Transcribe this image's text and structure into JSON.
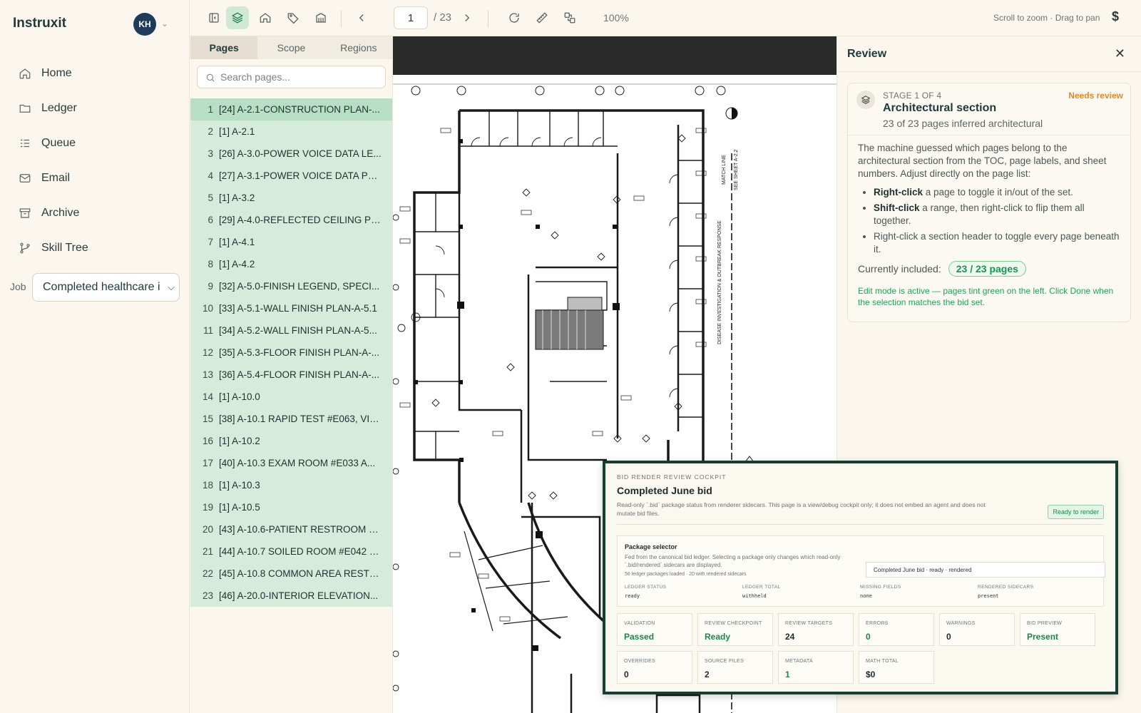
{
  "app": {
    "brand": "Instruxit",
    "avatar_initials": "KH"
  },
  "nav": {
    "items": [
      {
        "label": "Home",
        "icon": "home-icon"
      },
      {
        "label": "Ledger",
        "icon": "folder-icon"
      },
      {
        "label": "Queue",
        "icon": "list-icon"
      },
      {
        "label": "Email",
        "icon": "mail-icon"
      },
      {
        "label": "Archive",
        "icon": "archive-icon"
      },
      {
        "label": "Skill Tree",
        "icon": "branch-icon"
      }
    ],
    "job_label": "Job",
    "job_value": "Completed healthcare i"
  },
  "toolbar": {
    "page_current": "1",
    "page_total": "/ 23",
    "zoom": "100%",
    "hint": "Scroll to zoom · Drag to pan",
    "currency": "$"
  },
  "pages_panel": {
    "tabs": [
      "Pages",
      "Scope",
      "Regions"
    ],
    "search_placeholder": "Search pages...",
    "rows": [
      {
        "n": "1",
        "t": "[24] A-2.1-CONSTRUCTION PLAN-..."
      },
      {
        "n": "2",
        "t": "[1] A-2.1"
      },
      {
        "n": "3",
        "t": "[26] A-3.0-POWER VOICE DATA LE..."
      },
      {
        "n": "4",
        "t": "[27] A-3.1-POWER VOICE DATA PLA..."
      },
      {
        "n": "5",
        "t": "[1] A-3.2"
      },
      {
        "n": "6",
        "t": "[29] A-4.0-REFLECTED CEILING PL..."
      },
      {
        "n": "7",
        "t": "[1] A-4.1"
      },
      {
        "n": "8",
        "t": "[1] A-4.2"
      },
      {
        "n": "9",
        "t": "[32] A-5.0-FINISH LEGEND, SPECI..."
      },
      {
        "n": "10",
        "t": "[33] A-5.1-WALL FINISH PLAN-A-5.1"
      },
      {
        "n": "11",
        "t": "[34] A-5.2-WALL FINISH PLAN-A-5..."
      },
      {
        "n": "12",
        "t": "[35] A-5.3-FLOOR FINISH PLAN-A-..."
      },
      {
        "n": "13",
        "t": "[36] A-5.4-FLOOR FINISH PLAN-A-..."
      },
      {
        "n": "14",
        "t": "[1] A-10.0"
      },
      {
        "n": "15",
        "t": "[38] A-10.1 RAPID TEST #E063, VITA..."
      },
      {
        "n": "16",
        "t": "[1] A-10.2"
      },
      {
        "n": "17",
        "t": "[40] A-10.3 EXAM ROOM #E033 A..."
      },
      {
        "n": "18",
        "t": "[1] A-10.3"
      },
      {
        "n": "19",
        "t": "[1] A-10.5"
      },
      {
        "n": "20",
        "t": "[43] A-10.6-PATIENT RESTROOM #..."
      },
      {
        "n": "21",
        "t": "[44] A-10.7 SOILED ROOM #E042 &..."
      },
      {
        "n": "22",
        "t": "[45] A-10.8 COMMON AREA RESTR..."
      },
      {
        "n": "23",
        "t": "[46] A-20.0-INTERIOR ELEVATION..."
      }
    ]
  },
  "drawing": {
    "side_label_1": "DISEASE INVESTIGATION & OUTBREAK RESPONSE",
    "side_label_2": "MATCH LINE",
    "side_label_3": "SEE SHEET A-2.2"
  },
  "review": {
    "title": "Review",
    "stage_kicker": "STAGE 1 OF 4",
    "stage_status": "Needs review",
    "stage_title": "Architectural section",
    "stage_sub": "23 of 23 pages inferred architectural",
    "intro": "The machine guessed which pages belong to the architectural section from the TOC, page labels, and sheet numbers. Adjust directly on the page list:",
    "tips": [
      {
        "b": "Right-click",
        "t": " a page to toggle it in/out of the set."
      },
      {
        "b": "Shift-click",
        "t": " a range, then right-click to flip them all together."
      },
      {
        "b": "",
        "t": "Right-click a section header to toggle every page beneath it."
      }
    ],
    "included_label": "Currently included:",
    "included_value": "23 / 23 pages",
    "edit_note": "Edit mode is active — pages tint green on the left. Click Done when the selection matches the bid set."
  },
  "cockpit": {
    "kicker": "BID RENDER REVIEW COCKPIT",
    "title": "Completed June bid",
    "desc": "Read-only `.bid` package status from renderer sidecars. This page is a view/debug cockpit only; it does not embed an agent and does not mutate bid files.",
    "status_badge": "Ready to render",
    "pkg_title": "Package selector",
    "pkg_desc": "Fed from the canonical bid ledger. Selecting a package only changes which read-only `.bid/rendered` sidecars are displayed.",
    "pkg_meta": "56 ledger packages loaded · 20 with rendered sidecars",
    "pkg_select": "Completed June bid · ready · rendered",
    "pkg_fields": [
      {
        "k": "LEDGER STATUS",
        "v": "ready"
      },
      {
        "k": "LEDGER TOTAL",
        "v": "withheld"
      },
      {
        "k": "MISSING FIELDS",
        "v": "none"
      },
      {
        "k": "RENDERED SIDECARS",
        "v": "present"
      }
    ],
    "stats": [
      {
        "k": "VALIDATION",
        "v": "Passed",
        "green": true
      },
      {
        "k": "REVIEW CHECKPOINT",
        "v": "Ready",
        "green": true
      },
      {
        "k": "REVIEW TARGETS",
        "v": "24",
        "green": false
      },
      {
        "k": "ERRORS",
        "v": "0",
        "green": true
      },
      {
        "k": "WARNINGS",
        "v": "0",
        "green": false
      },
      {
        "k": "BID PREVIEW",
        "v": "Present",
        "green": true
      },
      {
        "k": "OVERRIDES",
        "v": "0",
        "green": false
      },
      {
        "k": "SOURCE FILES",
        "v": "2",
        "green": false
      },
      {
        "k": "METADATA",
        "v": "1",
        "green": true
      },
      {
        "k": "MATH TOTAL",
        "v": "$0",
        "green": false
      }
    ]
  }
}
